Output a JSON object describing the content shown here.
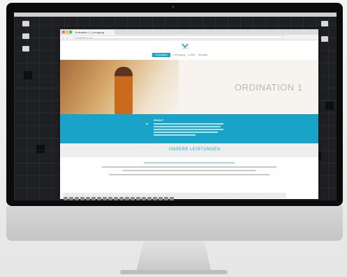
{
  "browser": {
    "tab_title": "Ordination 1 | Lerngang",
    "url": "ordination.ch"
  },
  "site": {
    "nav": {
      "items": [
        "Ordination",
        "Lerngang",
        "Lehre",
        "Kontakt"
      ],
      "active_index": 0
    },
    "hero": {
      "title": "ORDINATION 1"
    },
    "band": {
      "heading": "INHALT"
    },
    "cta": {
      "label": "UNSERE LEISTUNGEN"
    }
  },
  "colors": {
    "accent": "#1aa3c9",
    "hero_title": "#b9b9b9",
    "robe": "#c96a1e"
  },
  "icons": {
    "apple": "apple-logo-icon",
    "logo": "site-logo-icon",
    "band": "info-icon"
  }
}
